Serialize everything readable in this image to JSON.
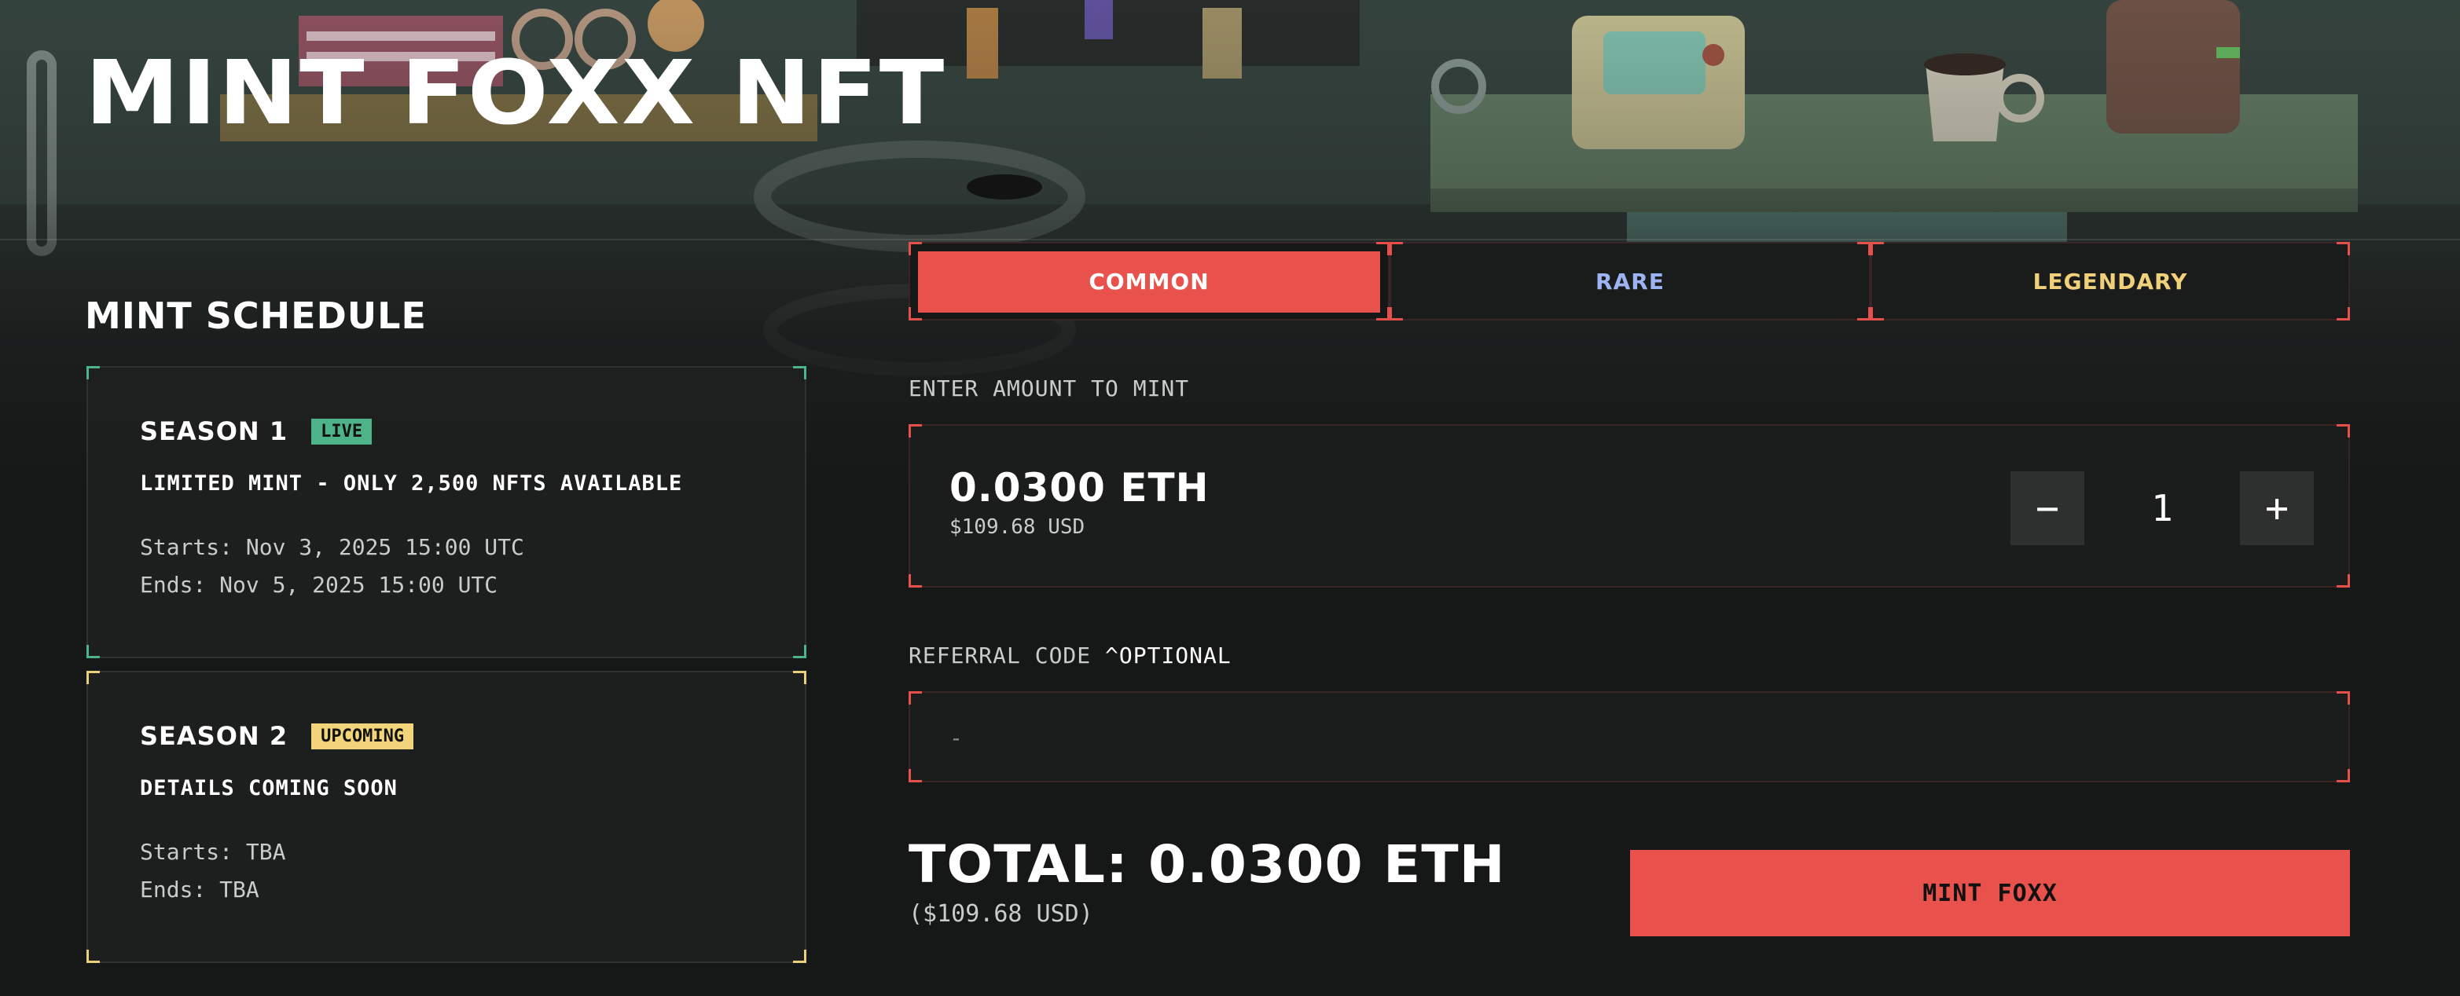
{
  "page_title": "MINT FOXX NFT",
  "schedule": {
    "heading": "MINT SCHEDULE",
    "seasons": [
      {
        "name": "SEASON 1",
        "badge": "LIVE",
        "description": "LIMITED MINT - ONLY 2,500 NFTS AVAILABLE",
        "starts": "Starts: Nov 3, 2025 15:00 UTC",
        "ends": "Ends: Nov 5, 2025 15:00 UTC"
      },
      {
        "name": "SEASON 2",
        "badge": "UPCOMING",
        "description": "DETAILS COMING SOON",
        "starts": "Starts: TBA",
        "ends": "Ends: TBA"
      }
    ]
  },
  "tiers": [
    {
      "label": "COMMON",
      "selected": true
    },
    {
      "label": "RARE",
      "selected": false
    },
    {
      "label": "LEGENDARY",
      "selected": false
    }
  ],
  "amount": {
    "label": "ENTER AMOUNT TO MINT",
    "price_eth": "0.0300 ETH",
    "price_usd": "$109.68 USD",
    "quantity": "1",
    "minus_symbol": "−",
    "plus_symbol": "+"
  },
  "referral": {
    "label": "REFERRAL CODE ",
    "optional": "^OPTIONAL",
    "placeholder": "-",
    "value": ""
  },
  "total": {
    "text": "TOTAL: 0.0300 ETH",
    "usd": "($109.68 USD)"
  },
  "mint_button": "MINT FOXX",
  "colors": {
    "accent_red": "#e8514c",
    "live_green": "#4fb38a",
    "upcoming_yellow": "#f2d57a",
    "rare_blue": "#9db4f2",
    "legendary_gold": "#f0d07a",
    "background": "#161717"
  }
}
